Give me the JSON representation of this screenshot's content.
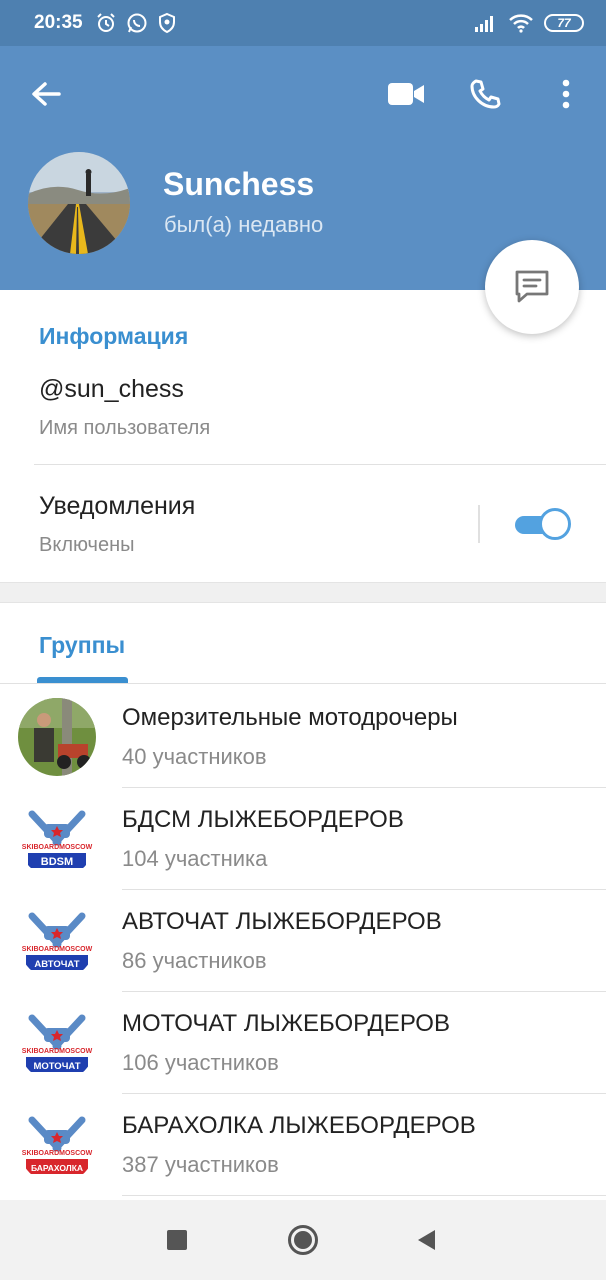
{
  "status_bar": {
    "time": "20:35",
    "battery": "77"
  },
  "header": {
    "name": "Sunchess",
    "status": "был(а) недавно"
  },
  "info": {
    "section_title": "Информация",
    "username": "@sun_chess",
    "username_label": "Имя пользователя",
    "notifications_title": "Уведомления",
    "notifications_state": "Включены",
    "notifications_enabled": true
  },
  "groups": {
    "tab_label": "Группы",
    "items": [
      {
        "name": "Омерзительные мотодрочеры",
        "count": "40 участников",
        "badge": ""
      },
      {
        "name": "БДСМ ЛЫЖЕБОРДЕРОВ",
        "count": "104 участника",
        "badge": "BDSM"
      },
      {
        "name": "АВТОЧАТ ЛЫЖЕБОРДЕРОВ",
        "count": "86 участников",
        "badge": "АВТОЧАТ"
      },
      {
        "name": "МОТОЧАТ ЛЫЖЕБОРДЕРОВ",
        "count": "106 участников",
        "badge": "МОТОЧАТ"
      },
      {
        "name": "БАРАХОЛКА ЛЫЖЕБОРДЕРОВ",
        "count": "387 участников",
        "badge": "БАРАХОЛКА"
      }
    ],
    "logo_text": "SKIBOARDMOSCOW"
  },
  "colors": {
    "status_bar": "#4e80b0",
    "header": "#5b8fc4",
    "accent": "#3a8fd0",
    "badge_blue": "#1f3fb0",
    "badge_red": "#d8262c"
  },
  "icons": {
    "back": "arrow-left-icon",
    "video": "video-camera-icon",
    "call": "phone-icon",
    "more": "more-vertical-icon",
    "message": "message-icon"
  }
}
